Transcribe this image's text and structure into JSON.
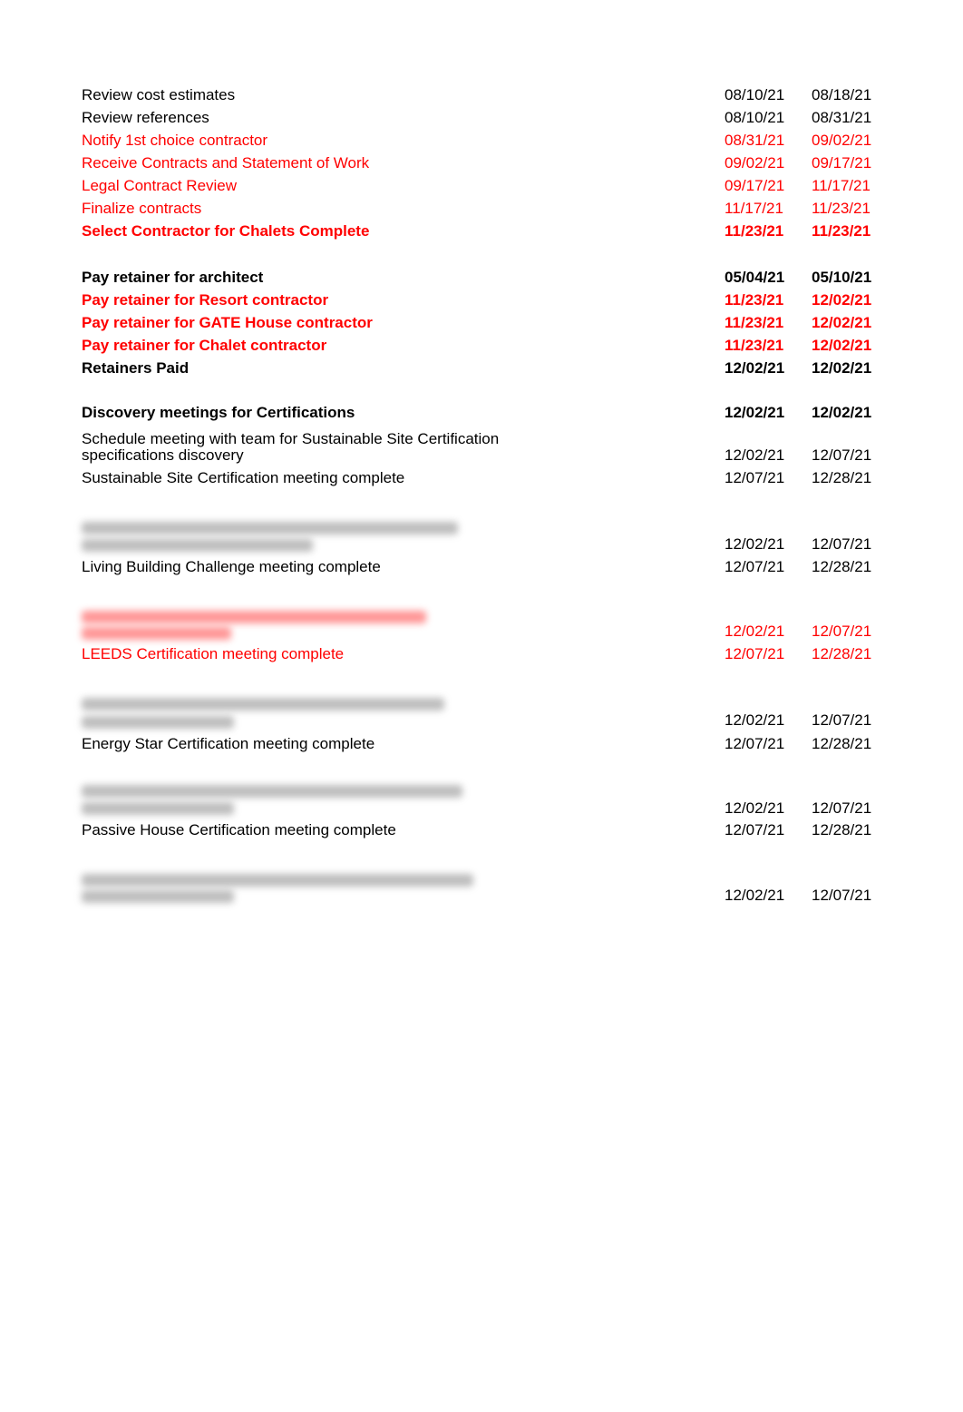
{
  "colors": {
    "highlight": "#ff0000",
    "text": "#000000"
  },
  "rows": [
    {
      "task": "Review cost estimates",
      "start": "08/10/21",
      "end": "08/18/21"
    },
    {
      "task": "Review references",
      "start": "08/10/21",
      "end": "08/31/21"
    },
    {
      "task": "Notify 1st choice contractor",
      "start": "08/31/21",
      "end": "09/02/21"
    },
    {
      "task": "Receive Contracts and Statement of Work",
      "start": "09/02/21",
      "end": "09/17/21"
    },
    {
      "task": "Legal Contract Review",
      "start": "09/17/21",
      "end": "11/17/21"
    },
    {
      "task": "Finalize contracts",
      "start": "11/17/21",
      "end": "11/23/21"
    },
    {
      "task": "Select Contractor for Chalets Complete",
      "start": "11/23/21",
      "end": "11/23/21"
    },
    {
      "task": "Pay retainer for architect",
      "start": "05/04/21",
      "end": "05/10/21"
    },
    {
      "task": "Pay retainer for Resort contractor",
      "start": "11/23/21",
      "end": "12/02/21"
    },
    {
      "task": "Pay retainer for GATE House contractor",
      "start": "11/23/21",
      "end": "12/02/21"
    },
    {
      "task": "Pay retainer for Chalet contractor",
      "start": "11/23/21",
      "end": "12/02/21"
    },
    {
      "task": "Retainers Paid",
      "start": "12/02/21",
      "end": "12/02/21"
    },
    {
      "task": "Discovery meetings for Certifications",
      "start": "12/02/21",
      "end": "12/02/21"
    },
    {
      "task": "Schedule meeting with team for Sustainable Site Certification",
      "task2": "specifications discovery",
      "start": "12/02/21",
      "end": "12/07/21"
    },
    {
      "task": "Sustainable Site Certification meeting complete",
      "start": "12/07/21",
      "end": "12/28/21"
    },
    {
      "start": "12/02/21",
      "end": "12/07/21"
    },
    {
      "task": "Living Building Challenge meeting complete",
      "start": "12/07/21",
      "end": "12/28/21"
    },
    {
      "start": "12/02/21",
      "end": "12/07/21"
    },
    {
      "task": "LEEDS Certification meeting complete",
      "start": "12/07/21",
      "end": "12/28/21"
    },
    {
      "start": "12/02/21",
      "end": "12/07/21"
    },
    {
      "task": "Energy Star Certification meeting complete",
      "start": "12/07/21",
      "end": "12/28/21"
    },
    {
      "start": "12/02/21",
      "end": "12/07/21"
    },
    {
      "task": "Passive House Certification meeting complete",
      "start": "12/07/21",
      "end": "12/28/21"
    },
    {
      "start": "12/02/21",
      "end": "12/07/21"
    }
  ]
}
